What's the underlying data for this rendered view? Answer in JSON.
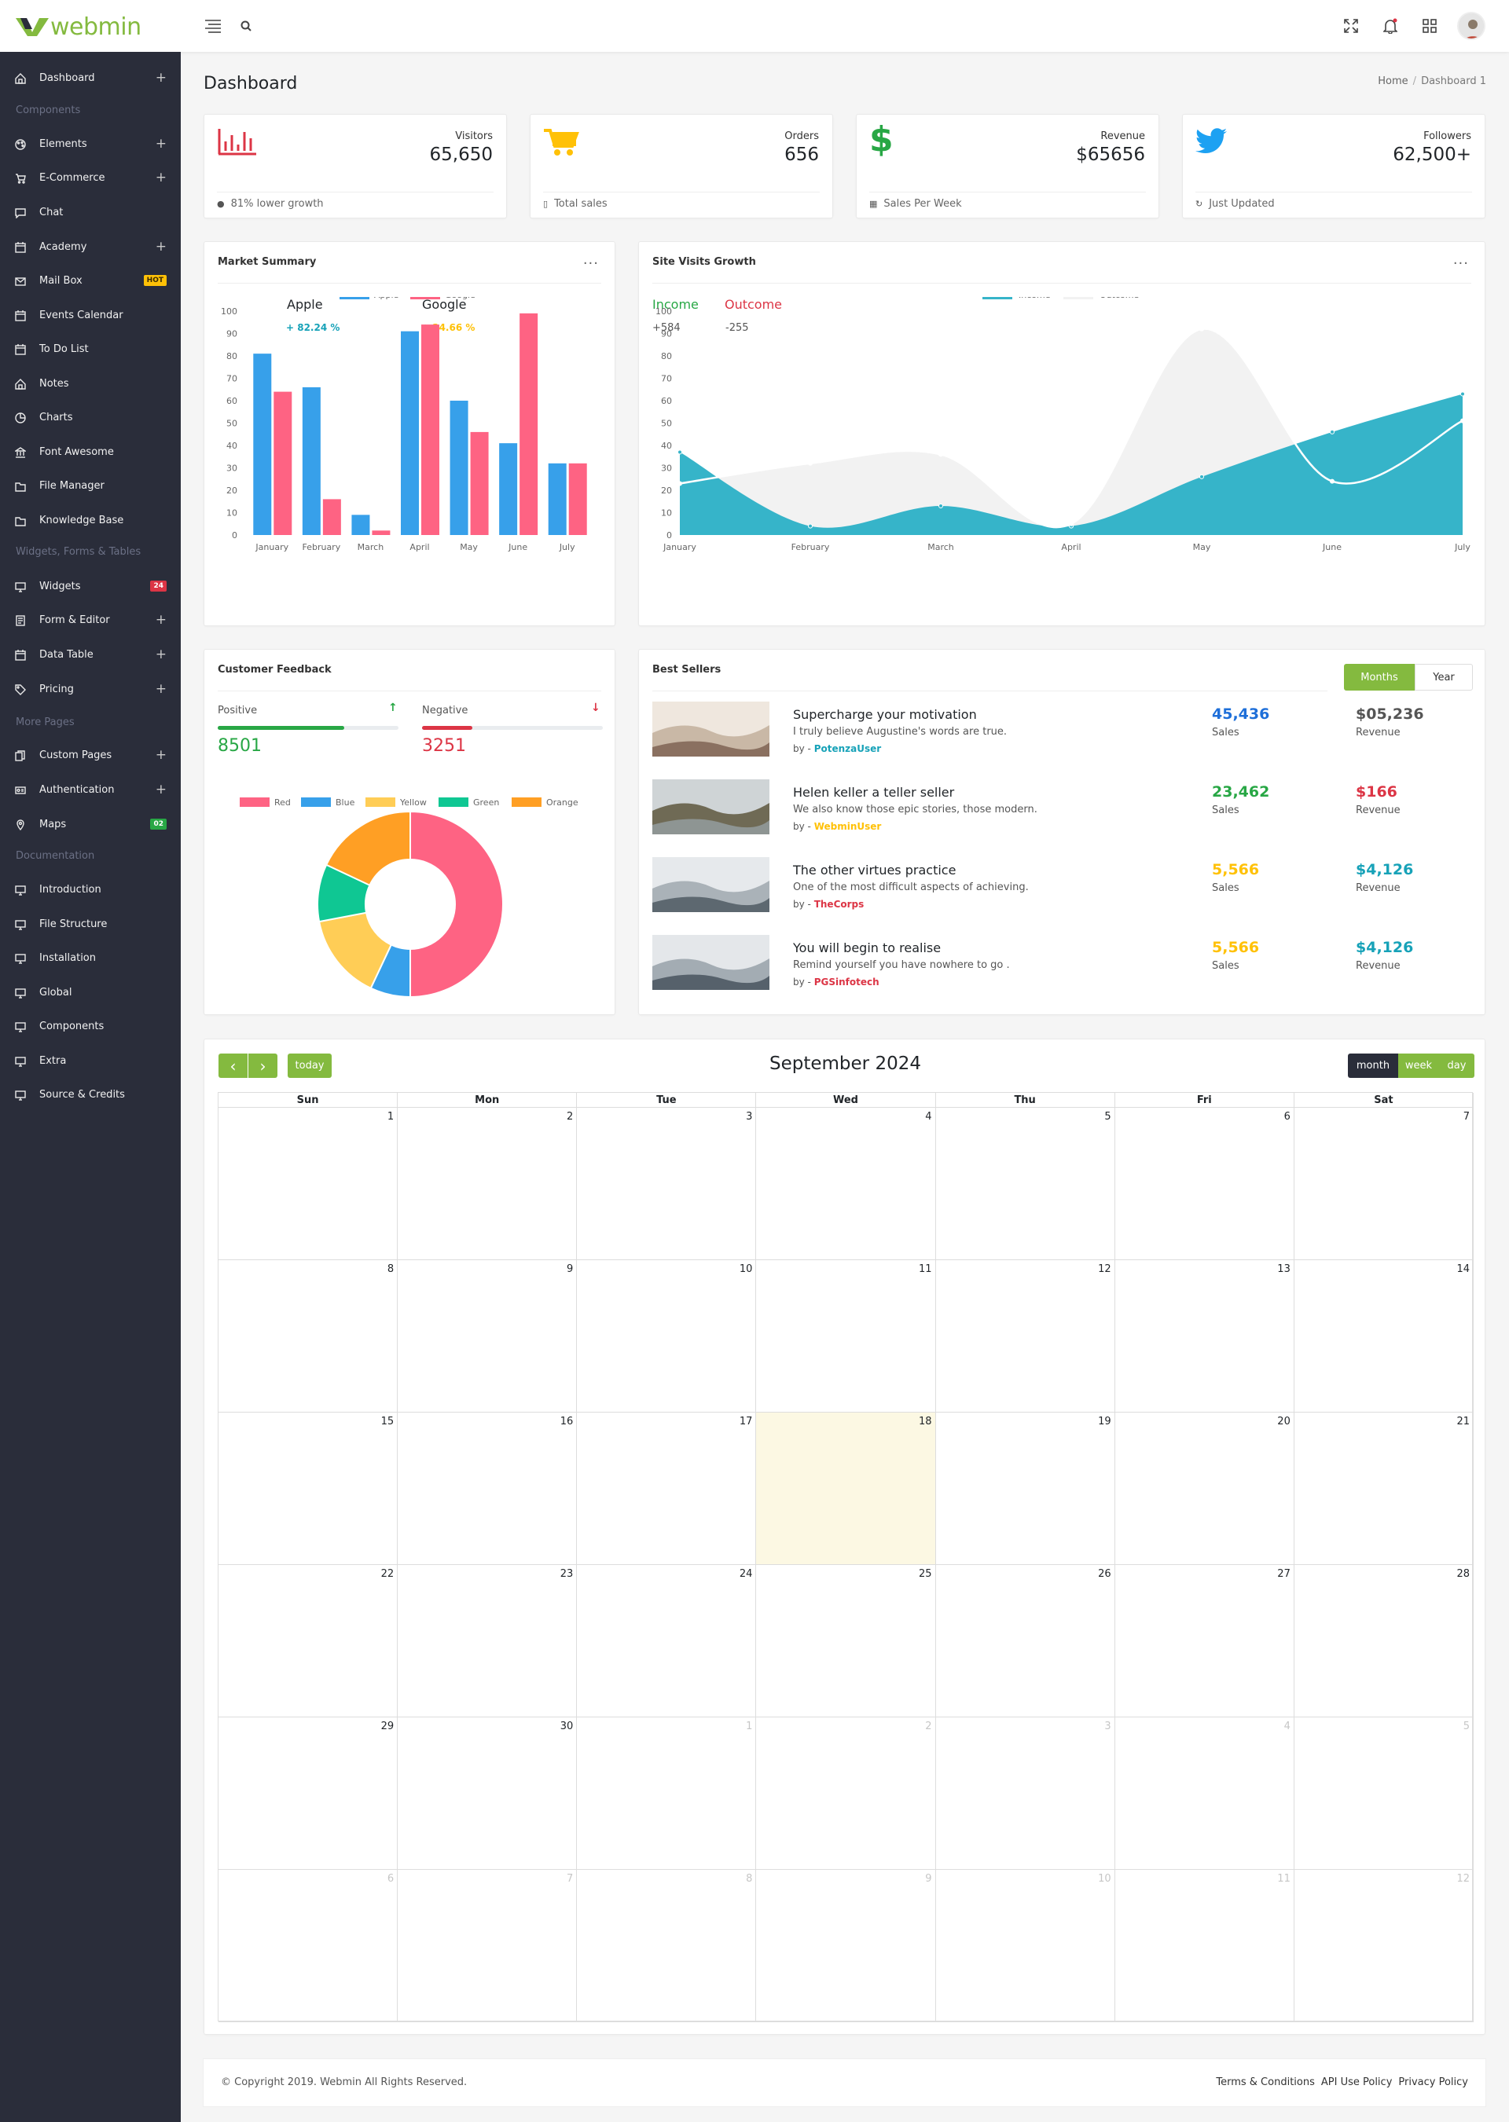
{
  "brand": {
    "name": "webmin"
  },
  "colors": {
    "accent": "#84ba3f",
    "sidebar": "#2a2d3a",
    "red": "#dc3545",
    "blue": "#37a0ea",
    "pink": "#fe6383",
    "yellow": "#ffc107",
    "teal": "#36b4c9",
    "green": "#28a745"
  },
  "sidebar": {
    "items": [
      {
        "label": "Dashboard",
        "icon": "home-icon",
        "plus": "+"
      },
      {
        "label": "Elements",
        "icon": "palette-icon",
        "plus": "+"
      },
      {
        "label": "E-Commerce",
        "icon": "cart-icon",
        "plus": "+"
      },
      {
        "label": "Chat",
        "icon": "chat-icon"
      },
      {
        "label": "Academy",
        "icon": "calendar-icon",
        "plus": "+"
      },
      {
        "label": "Mail Box",
        "icon": "mail-icon",
        "badge": "HOT",
        "badge_color": "#ffc107"
      },
      {
        "label": "Events Calendar",
        "icon": "calendar-icon"
      },
      {
        "label": "To Do List",
        "icon": "calendar-icon"
      },
      {
        "label": "Notes",
        "icon": "home-icon"
      },
      {
        "label": "Charts",
        "icon": "pie-icon"
      },
      {
        "label": "Font Awesome",
        "icon": "bank-icon"
      },
      {
        "label": "File Manager",
        "icon": "folder-icon"
      },
      {
        "label": "Knowledge Base",
        "icon": "folder-icon"
      },
      {
        "label": "Widgets",
        "icon": "monitor-icon",
        "badge": "24",
        "badge_color": "#dc3545"
      },
      {
        "label": "Form & Editor",
        "icon": "form-icon",
        "plus": "+"
      },
      {
        "label": "Data Table",
        "icon": "calendar-icon",
        "plus": "+"
      },
      {
        "label": "Pricing",
        "icon": "tag-icon",
        "plus": "+"
      },
      {
        "label": "Custom Pages",
        "icon": "pages-icon",
        "plus": "+"
      },
      {
        "label": "Authentication",
        "icon": "id-icon",
        "plus": "+"
      },
      {
        "label": "Maps",
        "icon": "pin-icon",
        "badge": "02",
        "badge_color": "#28a745"
      },
      {
        "label": "Introduction",
        "icon": "monitor-icon"
      },
      {
        "label": "File Structure",
        "icon": "monitor-icon"
      },
      {
        "label": "Installation",
        "icon": "monitor-icon"
      },
      {
        "label": "Global",
        "icon": "monitor-icon"
      },
      {
        "label": "Components",
        "icon": "monitor-icon"
      },
      {
        "label": "Extra",
        "icon": "monitor-icon"
      },
      {
        "label": "Source & Credits",
        "icon": "monitor-icon"
      }
    ],
    "headings": [
      "Components",
      "Widgets, Forms & Tables",
      "More Pages",
      "Documentation"
    ]
  },
  "page": {
    "title": "Dashboard",
    "breadcrumb_home": "Home",
    "breadcrumb_current": "Dashboard 1"
  },
  "stats": [
    {
      "label": "Visitors",
      "value": "65,650",
      "foot": "81% lower growth",
      "icon": "bar-chart-icon",
      "color": "#dc3545"
    },
    {
      "label": "Orders",
      "value": "656",
      "foot": "Total sales",
      "icon": "cart-icon",
      "color": "#ffc107"
    },
    {
      "label": "Revenue",
      "value": "$65656",
      "foot": "Sales Per Week",
      "icon": "dollar-icon",
      "color": "#28a745"
    },
    {
      "label": "Followers",
      "value": "62,500+",
      "foot": "Just Updated",
      "icon": "twitter-icon",
      "color": "#1da1f2"
    }
  ],
  "market": {
    "title": "Market Summary",
    "menu": "...",
    "apple_name": "Apple",
    "apple_change": "+ 82.24 %",
    "google_name": "Google",
    "google_change": "+ 24.66 %"
  },
  "site_visits": {
    "title": "Site Visits Growth",
    "menu": "...",
    "income_label": "Income",
    "income_value": "+584",
    "outcome_label": "Outcome",
    "outcome_value": "-255"
  },
  "feedback": {
    "title": "Customer Feedback",
    "positive_label": "Positive",
    "positive_value": "8501",
    "positive_progress": 0.7,
    "negative_label": "Negative",
    "negative_value": "3251",
    "negative_progress": 0.28
  },
  "best_sellers": {
    "title": "Best Sellers",
    "tab_months": "Months",
    "tab_year": "Year",
    "sales_label": "Sales",
    "revenue_label": "Revenue",
    "by_prefix": "by -",
    "items": [
      {
        "title": "Supercharge your motivation",
        "desc": "I truly believe Augustine's words are true.",
        "author": "PotenzaUser",
        "author_color": "#17a2b8",
        "sales": "45,436",
        "sales_color": "#1e6fd9",
        "revenue": "$05,236",
        "revenue_color": "#555555",
        "thumb": "photo-icon"
      },
      {
        "title": "Helen keller a teller seller",
        "desc": "We also know those epic stories, those modern.",
        "author": "WebminUser",
        "author_color": "#ffc107",
        "sales": "23,462",
        "sales_color": "#28a745",
        "revenue": "$166",
        "revenue_color": "#dc3545",
        "thumb": "photo-icon"
      },
      {
        "title": "The other virtues practice",
        "desc": "One of the most difficult aspects of achieving.",
        "author": "TheCorps",
        "author_color": "#dc3545",
        "sales": "5,566",
        "sales_color": "#ffc107",
        "revenue": "$4,126",
        "revenue_color": "#17a2b8",
        "thumb": "photo-icon"
      },
      {
        "title": "You will begin to realise",
        "desc": "Remind yourself you have nowhere to go .",
        "author": "PGSinfotech",
        "author_color": "#dc3545",
        "sales": "5,566",
        "sales_color": "#ffc107",
        "revenue": "$4,126",
        "revenue_color": "#17a2b8",
        "thumb": "photo-icon"
      }
    ]
  },
  "calendar": {
    "title": "September 2024",
    "today_label": "today",
    "prev": "‹",
    "next": "›",
    "view_month": "month",
    "view_week": "week",
    "view_day": "day",
    "days": [
      "Sun",
      "Mon",
      "Tue",
      "Wed",
      "Thu",
      "Fri",
      "Sat"
    ],
    "weeks": [
      [
        "1",
        "2",
        "3",
        "4",
        "5",
        "6",
        "7"
      ],
      [
        "8",
        "9",
        "10",
        "11",
        "12",
        "13",
        "14"
      ],
      [
        "15",
        "16",
        "17",
        "18",
        "19",
        "20",
        "21"
      ],
      [
        "22",
        "23",
        "24",
        "25",
        "26",
        "27",
        "28"
      ],
      [
        "29",
        "30",
        "1",
        "2",
        "3",
        "4",
        "5"
      ],
      [
        "6",
        "7",
        "8",
        "9",
        "10",
        "11",
        "12"
      ]
    ],
    "today_date": "18"
  },
  "footer": {
    "copyright": "© Copyright 2019. Webmin All Rights Reserved.",
    "links": [
      "Terms & Conditions",
      "API Use Policy",
      "Privacy Policy"
    ]
  },
  "chart_data": [
    {
      "type": "bar",
      "title": "Market Summary",
      "categories": [
        "January",
        "February",
        "March",
        "April",
        "May",
        "June",
        "July"
      ],
      "series": [
        {
          "name": "Apple",
          "color": "#37a0ea",
          "values": [
            81,
            66,
            9,
            91,
            60,
            41,
            32
          ]
        },
        {
          "name": "Google",
          "color": "#fe6383",
          "values": [
            64,
            16,
            2,
            94,
            46,
            99,
            32
          ]
        }
      ],
      "ylim": [
        0,
        100
      ],
      "yticks": [
        0,
        10,
        20,
        30,
        40,
        50,
        60,
        70,
        80,
        90,
        100
      ],
      "legend": "top"
    },
    {
      "type": "area",
      "title": "Site Visits Growth",
      "categories": [
        "January",
        "February",
        "March",
        "April",
        "May",
        "June",
        "July"
      ],
      "series": [
        {
          "name": "Income",
          "color": "#36b4c9",
          "values": [
            37,
            4,
            13,
            4,
            26,
            46,
            63
          ]
        },
        {
          "name": "Outcome",
          "color": "#f2f2f2",
          "values": [
            23,
            32,
            36,
            5,
            92,
            24,
            51
          ]
        }
      ],
      "ylim": [
        0,
        100
      ],
      "yticks": [
        0,
        10,
        20,
        30,
        40,
        50,
        60,
        70,
        80,
        90,
        100
      ],
      "legend": "top"
    },
    {
      "type": "pie",
      "title": "",
      "labels": [
        "Red",
        "Blue",
        "Yellow",
        "Green",
        "Orange"
      ],
      "colors": [
        "#fe6383",
        "#37a0ea",
        "#ffcd56",
        "#0fc793",
        "#ff9f24"
      ],
      "values": [
        50,
        7,
        15,
        10,
        18
      ],
      "legend": "top"
    }
  ]
}
